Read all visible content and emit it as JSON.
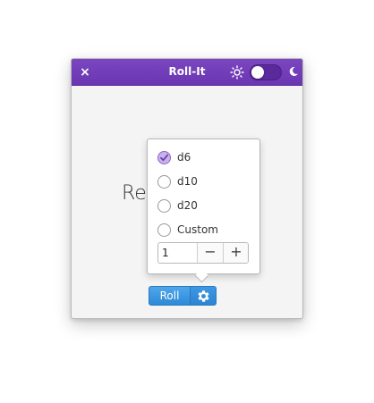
{
  "window": {
    "title": "Roll-It",
    "close_glyph": "×",
    "dark_mode_enabled": false,
    "icons": {
      "close": "close-icon",
      "light": "sun-icon",
      "dark": "moon-icon"
    }
  },
  "main": {
    "result_text": "Re"
  },
  "dice_popover": {
    "options": [
      {
        "label": "d6",
        "checked": true
      },
      {
        "label": "d10",
        "checked": false
      },
      {
        "label": "d20",
        "checked": false
      },
      {
        "label": "Custom",
        "checked": false
      }
    ],
    "custom_value": "1",
    "decrement_label": "−",
    "increment_label": "+"
  },
  "actions": {
    "roll_label": "Roll",
    "settings_icon": "gear-icon"
  },
  "colors": {
    "titlebar": "#6a36b1",
    "accent_blue": "#2f8ad8",
    "radio_checked": "#8b63c9"
  }
}
